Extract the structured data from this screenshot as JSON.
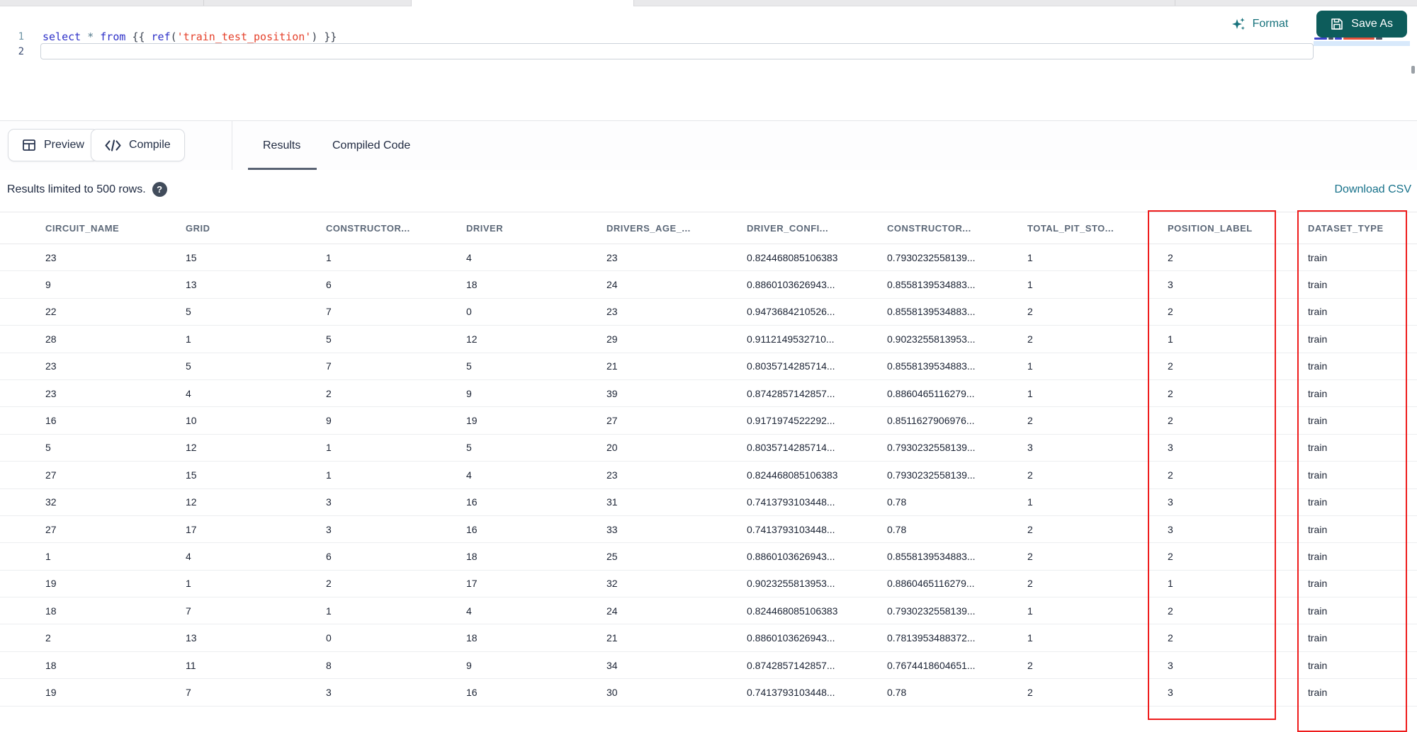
{
  "editor": {
    "format_label": "Format",
    "save_as_label": "Save As",
    "line_numbers": [
      "1",
      "2"
    ],
    "code_text": "select * from {{ ref('train_test_position') }}",
    "code_tokens": [
      {
        "t": "select",
        "c": "kw"
      },
      {
        "t": " ",
        "c": "plain"
      },
      {
        "t": "*",
        "c": "op"
      },
      {
        "t": " ",
        "c": "plain"
      },
      {
        "t": "from",
        "c": "kw"
      },
      {
        "t": " ",
        "c": "plain"
      },
      {
        "t": "{{ ",
        "c": "punct"
      },
      {
        "t": "ref",
        "c": "fn"
      },
      {
        "t": "(",
        "c": "punct"
      },
      {
        "t": "'train_test_position'",
        "c": "str"
      },
      {
        "t": ") ",
        "c": "punct"
      },
      {
        "t": "}}",
        "c": "punct"
      }
    ]
  },
  "toolbar": {
    "preview_label": "Preview",
    "compile_label": "Compile",
    "tabs": [
      {
        "label": "Results",
        "active": true
      },
      {
        "label": "Compiled Code",
        "active": false
      }
    ]
  },
  "results_meta": {
    "limit_text": "Results limited to 500 rows.",
    "help_icon": "?",
    "download_csv_label": "Download CSV"
  },
  "table": {
    "columns": [
      "CIRCUIT_NAME",
      "GRID",
      "CONSTRUCTOR...",
      "DRIVER",
      "DRIVERS_AGE_...",
      "DRIVER_CONFI...",
      "CONSTRUCTOR...",
      "TOTAL_PIT_STO...",
      "POSITION_LABEL",
      "DATASET_TYPE"
    ],
    "rows": [
      [
        "23",
        "15",
        "1",
        "4",
        "23",
        "0.824468085106383",
        "0.7930232558139...",
        "1",
        "2",
        "train"
      ],
      [
        "9",
        "13",
        "6",
        "18",
        "24",
        "0.8860103626943...",
        "0.8558139534883...",
        "1",
        "3",
        "train"
      ],
      [
        "22",
        "5",
        "7",
        "0",
        "23",
        "0.9473684210526...",
        "0.8558139534883...",
        "2",
        "2",
        "train"
      ],
      [
        "28",
        "1",
        "5",
        "12",
        "29",
        "0.9112149532710...",
        "0.9023255813953...",
        "2",
        "1",
        "train"
      ],
      [
        "23",
        "5",
        "7",
        "5",
        "21",
        "0.8035714285714...",
        "0.8558139534883...",
        "1",
        "2",
        "train"
      ],
      [
        "23",
        "4",
        "2",
        "9",
        "39",
        "0.8742857142857...",
        "0.8860465116279...",
        "1",
        "2",
        "train"
      ],
      [
        "16",
        "10",
        "9",
        "19",
        "27",
        "0.9171974522292...",
        "0.8511627906976...",
        "2",
        "2",
        "train"
      ],
      [
        "5",
        "12",
        "1",
        "5",
        "20",
        "0.8035714285714...",
        "0.7930232558139...",
        "3",
        "3",
        "train"
      ],
      [
        "27",
        "15",
        "1",
        "4",
        "23",
        "0.824468085106383",
        "0.7930232558139...",
        "2",
        "2",
        "train"
      ],
      [
        "32",
        "12",
        "3",
        "16",
        "31",
        "0.7413793103448...",
        "0.78",
        "1",
        "3",
        "train"
      ],
      [
        "27",
        "17",
        "3",
        "16",
        "33",
        "0.7413793103448...",
        "0.78",
        "2",
        "3",
        "train"
      ],
      [
        "1",
        "4",
        "6",
        "18",
        "25",
        "0.8860103626943...",
        "0.8558139534883...",
        "2",
        "2",
        "train"
      ],
      [
        "19",
        "1",
        "2",
        "17",
        "32",
        "0.9023255813953...",
        "0.8860465116279...",
        "2",
        "1",
        "train"
      ],
      [
        "18",
        "7",
        "1",
        "4",
        "24",
        "0.824468085106383",
        "0.7930232558139...",
        "1",
        "2",
        "train"
      ],
      [
        "2",
        "13",
        "0",
        "18",
        "21",
        "0.8860103626943...",
        "0.7813953488372...",
        "1",
        "2",
        "train"
      ],
      [
        "18",
        "11",
        "8",
        "9",
        "34",
        "0.8742857142857...",
        "0.7674418604651...",
        "2",
        "3",
        "train"
      ],
      [
        "19",
        "7",
        "3",
        "16",
        "30",
        "0.7413793103448...",
        "0.78",
        "2",
        "3",
        "train"
      ]
    ],
    "highlighted_columns": [
      "POSITION_LABEL",
      "DATASET_TYPE"
    ]
  },
  "colors": {
    "accent_teal": "#0d5c5b",
    "link_teal": "#17718a",
    "annotation_red": "#ee1c1c",
    "keyword_blue": "#2e31c8",
    "string_red": "#e5422c"
  }
}
